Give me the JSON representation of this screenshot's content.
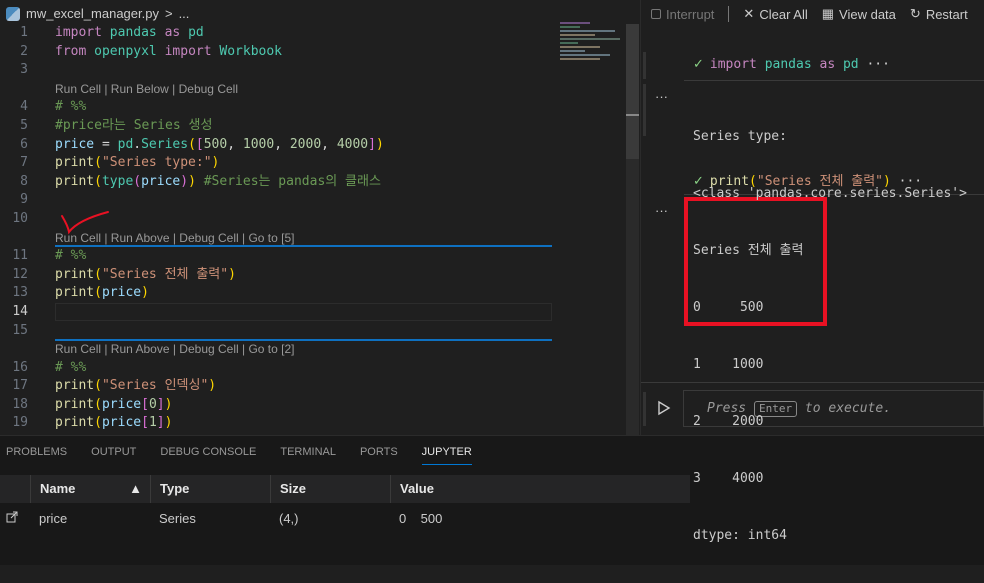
{
  "breadcrumb": {
    "file": "mw_excel_manager.py",
    "separator": ">",
    "more": "..."
  },
  "editor": {
    "rows": [
      {
        "type": "line",
        "n": "1",
        "tokens": [
          [
            "import",
            "kw"
          ],
          [
            " ",
            "pl"
          ],
          [
            "pandas",
            "mod"
          ],
          [
            " ",
            "pl"
          ],
          [
            "as",
            "kw"
          ],
          [
            " ",
            "pl"
          ],
          [
            "pd",
            "mod"
          ]
        ]
      },
      {
        "type": "line",
        "n": "2",
        "tokens": [
          [
            "from",
            "kw"
          ],
          [
            " ",
            "pl"
          ],
          [
            "openpyxl",
            "mod"
          ],
          [
            " ",
            "pl"
          ],
          [
            "import",
            "kw"
          ],
          [
            " ",
            "pl"
          ],
          [
            "Workbook",
            "mod"
          ]
        ]
      },
      {
        "type": "line",
        "n": "3",
        "tokens": []
      },
      {
        "type": "lens",
        "text": "Run Cell | Run Below | Debug Cell"
      },
      {
        "type": "line",
        "n": "4",
        "tokens": [
          [
            "# %%",
            "cm"
          ]
        ]
      },
      {
        "type": "line",
        "n": "5",
        "tokens": [
          [
            "#price라는 Series 생성",
            "cm"
          ]
        ]
      },
      {
        "type": "line",
        "n": "6",
        "tokens": [
          [
            "price",
            "var"
          ],
          [
            " = ",
            "pl"
          ],
          [
            "pd",
            "mod"
          ],
          [
            ".",
            "pl"
          ],
          [
            "Series",
            "mod"
          ],
          [
            "(",
            "b1"
          ],
          [
            "[",
            "b2"
          ],
          [
            "500",
            "num"
          ],
          [
            ", ",
            "pl"
          ],
          [
            "1000",
            "num"
          ],
          [
            ", ",
            "pl"
          ],
          [
            "2000",
            "num"
          ],
          [
            ", ",
            "pl"
          ],
          [
            "4000",
            "num"
          ],
          [
            "]",
            "b2"
          ],
          [
            ")",
            "b1"
          ]
        ]
      },
      {
        "type": "line",
        "n": "7",
        "tokens": [
          [
            "print",
            "fn"
          ],
          [
            "(",
            "b1"
          ],
          [
            "\"Series type:\"",
            "str"
          ],
          [
            ")",
            "b1"
          ]
        ]
      },
      {
        "type": "line",
        "n": "8",
        "tokens": [
          [
            "print",
            "fn"
          ],
          [
            "(",
            "b1"
          ],
          [
            "type",
            "mod"
          ],
          [
            "(",
            "b2"
          ],
          [
            "price",
            "var"
          ],
          [
            ")",
            "b2"
          ],
          [
            ")",
            "b1"
          ],
          [
            " ",
            "pl"
          ],
          [
            "#Series는 pandas의 클래스",
            "cm"
          ]
        ]
      },
      {
        "type": "line",
        "n": "9",
        "tokens": []
      },
      {
        "type": "line",
        "n": "10",
        "tokens": []
      },
      {
        "type": "lens",
        "text": "Run Cell | Run Above | Debug Cell | Go to [5]"
      },
      {
        "type": "line",
        "n": "11",
        "tokens": [
          [
            "# %%",
            "cm"
          ]
        ]
      },
      {
        "type": "line",
        "n": "12",
        "tokens": [
          [
            "print",
            "fn"
          ],
          [
            "(",
            "b1"
          ],
          [
            "\"Series 전체 출력\"",
            "str"
          ],
          [
            ")",
            "b1"
          ]
        ]
      },
      {
        "type": "line",
        "n": "13",
        "tokens": [
          [
            "print",
            "fn"
          ],
          [
            "(",
            "b1"
          ],
          [
            "price",
            "var"
          ],
          [
            ")",
            "b1"
          ]
        ]
      },
      {
        "type": "line",
        "n": "14",
        "tokens": [],
        "current": true
      },
      {
        "type": "line",
        "n": "15",
        "tokens": []
      },
      {
        "type": "lens",
        "text": "Run Cell | Run Above | Debug Cell | Go to [2]"
      },
      {
        "type": "line",
        "n": "16",
        "tokens": [
          [
            "# %%",
            "cm"
          ]
        ]
      },
      {
        "type": "line",
        "n": "17",
        "tokens": [
          [
            "print",
            "fn"
          ],
          [
            "(",
            "b1"
          ],
          [
            "\"Series 인덱싱\"",
            "str"
          ],
          [
            ")",
            "b1"
          ]
        ]
      },
      {
        "type": "line",
        "n": "18",
        "tokens": [
          [
            "print",
            "fn"
          ],
          [
            "(",
            "b1"
          ],
          [
            "price",
            "var"
          ],
          [
            "[",
            "b2"
          ],
          [
            "0",
            "num"
          ],
          [
            "]",
            "b2"
          ],
          [
            ")",
            "b1"
          ]
        ]
      },
      {
        "type": "line",
        "n": "19",
        "tokens": [
          [
            "print",
            "fn"
          ],
          [
            "(",
            "b1"
          ],
          [
            "price",
            "var"
          ],
          [
            "[",
            "b2"
          ],
          [
            "1",
            "num"
          ],
          [
            "]",
            "b2"
          ],
          [
            ")",
            "b1"
          ]
        ]
      }
    ]
  },
  "interactive": {
    "toolbar": {
      "interrupt": "Interrupt",
      "clear_all": "Clear All",
      "view_data": "View data",
      "restart": "Restart"
    },
    "cells": [
      {
        "header_tokens": [
          [
            "import",
            "kw"
          ],
          [
            " ",
            "pl"
          ],
          [
            "pandas",
            "mod"
          ],
          [
            " ",
            "pl"
          ],
          [
            "as",
            "kw"
          ],
          [
            " ",
            "pl"
          ],
          [
            "pd",
            "mod"
          ]
        ],
        "ellipsis": "···",
        "output": [
          "Series type:",
          "<class 'pandas.core.series.Series'>"
        ]
      },
      {
        "header_tokens": [
          [
            "print",
            "fn"
          ],
          [
            "(",
            "b1"
          ],
          [
            "\"Series 전체 출력\"",
            "str"
          ],
          [
            ")",
            "b1"
          ]
        ],
        "ellipsis": "···",
        "output": [
          "Series 전체 출력",
          "0     500",
          "1    1000",
          "2    2000",
          "3    4000",
          "dtype: int64"
        ]
      }
    ],
    "output_more": "···",
    "input": {
      "press": "Press",
      "key": "Enter",
      "suffix": "to execute."
    }
  },
  "panel": {
    "tabs": [
      "PROBLEMS",
      "OUTPUT",
      "DEBUG CONSOLE",
      "TERMINAL",
      "PORTS",
      "JUPYTER"
    ],
    "active_tab": "JUPYTER",
    "variables": {
      "columns": [
        "Name",
        "Type",
        "Size",
        "Value"
      ],
      "sort_indicator": "▲",
      "rows": [
        {
          "name": "price",
          "type": "Series",
          "size": "(4,)",
          "value": "0    500"
        }
      ]
    }
  },
  "colors": {
    "accent": "#0078d4",
    "annotation": "#e81123",
    "success": "#89d185"
  }
}
